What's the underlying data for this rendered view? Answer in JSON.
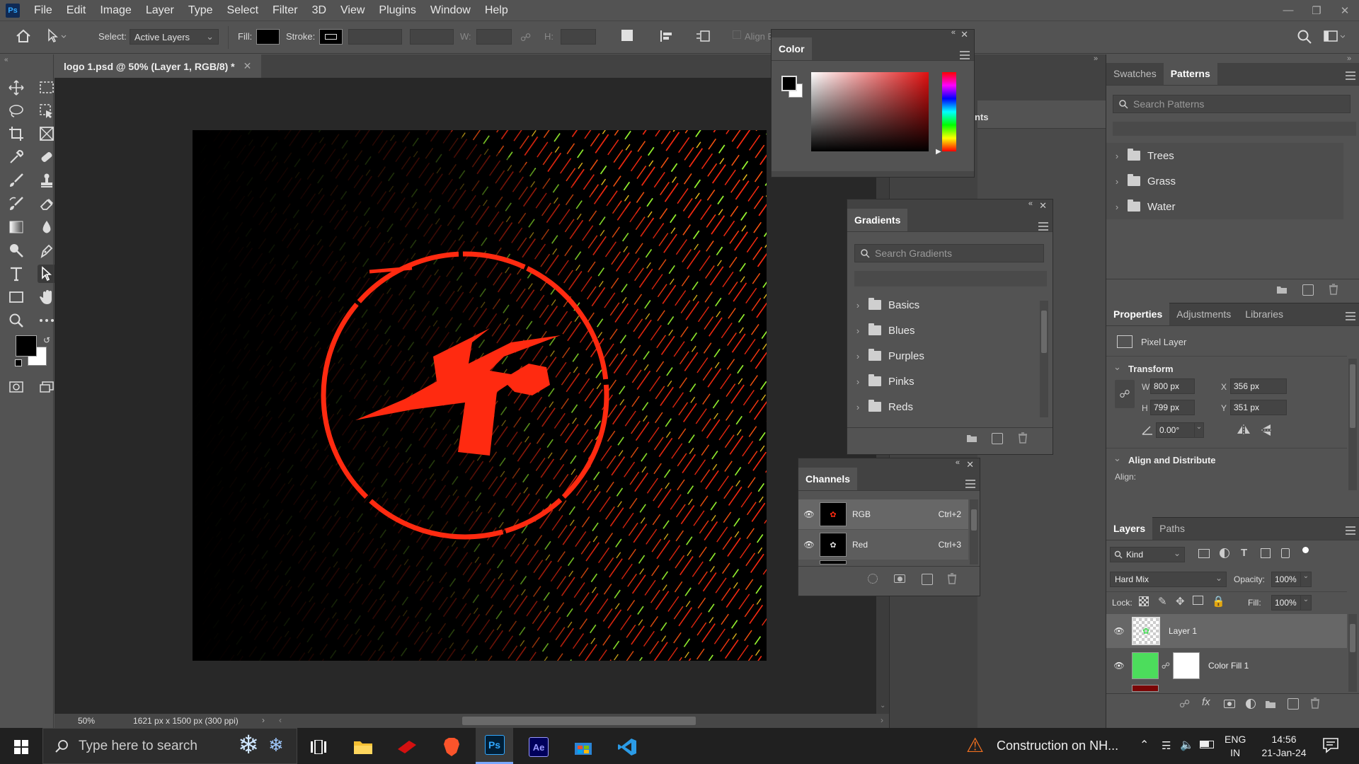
{
  "menu": {
    "app_icon": "Ps",
    "items": [
      "File",
      "Edit",
      "Image",
      "Layer",
      "Type",
      "Select",
      "Filter",
      "3D",
      "View",
      "Plugins",
      "Window",
      "Help"
    ]
  },
  "options_bar": {
    "select_label": "Select:",
    "select_value": "Active Layers",
    "fill_label": "Fill:",
    "stroke_label": "Stroke:",
    "w_label": "W:",
    "h_label": "H:",
    "align_label": "Align E"
  },
  "document": {
    "tab_title": "logo 1.psd @ 50% (Layer 1, RGB/8) *",
    "zoom": "50%",
    "doc_info": "1621 px x 1500 px (300 ppi)"
  },
  "color_panel": {
    "title": "Color"
  },
  "partial_panel_label": "nts",
  "patterns_panel": {
    "tabs": [
      "Swatches",
      "Patterns"
    ],
    "active_tab": "Patterns",
    "search_placeholder": "Search Patterns",
    "folders": [
      "Trees",
      "Grass",
      "Water"
    ]
  },
  "gradients_panel": {
    "title": "Gradients",
    "search_placeholder": "Search Gradients",
    "folders": [
      "Basics",
      "Blues",
      "Purples",
      "Pinks",
      "Reds"
    ]
  },
  "channels_panel": {
    "title": "Channels",
    "channels": [
      {
        "name": "RGB",
        "shortcut": "Ctrl+2"
      },
      {
        "name": "Red",
        "shortcut": "Ctrl+3"
      }
    ]
  },
  "properties_panel": {
    "tabs": [
      "Properties",
      "Adjustments",
      "Libraries"
    ],
    "layer_type": "Pixel Layer",
    "transform_label": "Transform",
    "w_label": "W",
    "w": "800 px",
    "h_label": "H",
    "h": "799 px",
    "x_label": "X",
    "x": "356 px",
    "y_label": "Y",
    "y": "351 px",
    "angle": "0.00°",
    "align_section": "Align and Distribute",
    "align_label": "Align:"
  },
  "layers_panel": {
    "tabs": [
      "Layers",
      "Paths"
    ],
    "filter_kind": "Kind",
    "blend_mode": "Hard Mix",
    "opacity_label": "Opacity:",
    "opacity": "100%",
    "lock_label": "Lock:",
    "fill_label": "Fill:",
    "fill": "100%",
    "layers": [
      {
        "name": "Layer 1",
        "selected": true
      },
      {
        "name": "Color Fill 1",
        "selected": false
      }
    ]
  },
  "taskbar": {
    "search_placeholder": "Type here to search",
    "news": "Construction on NH...",
    "language": "ENG",
    "region": "IN",
    "time": "14:56",
    "date": "21-Jan-24"
  },
  "colors": {
    "ui_bg": "#535353",
    "canvas_bg": "#282828",
    "accent_red": "#ff2a10",
    "fill_green": "#4cdd5c",
    "ps_blue": "#31a8ff"
  }
}
